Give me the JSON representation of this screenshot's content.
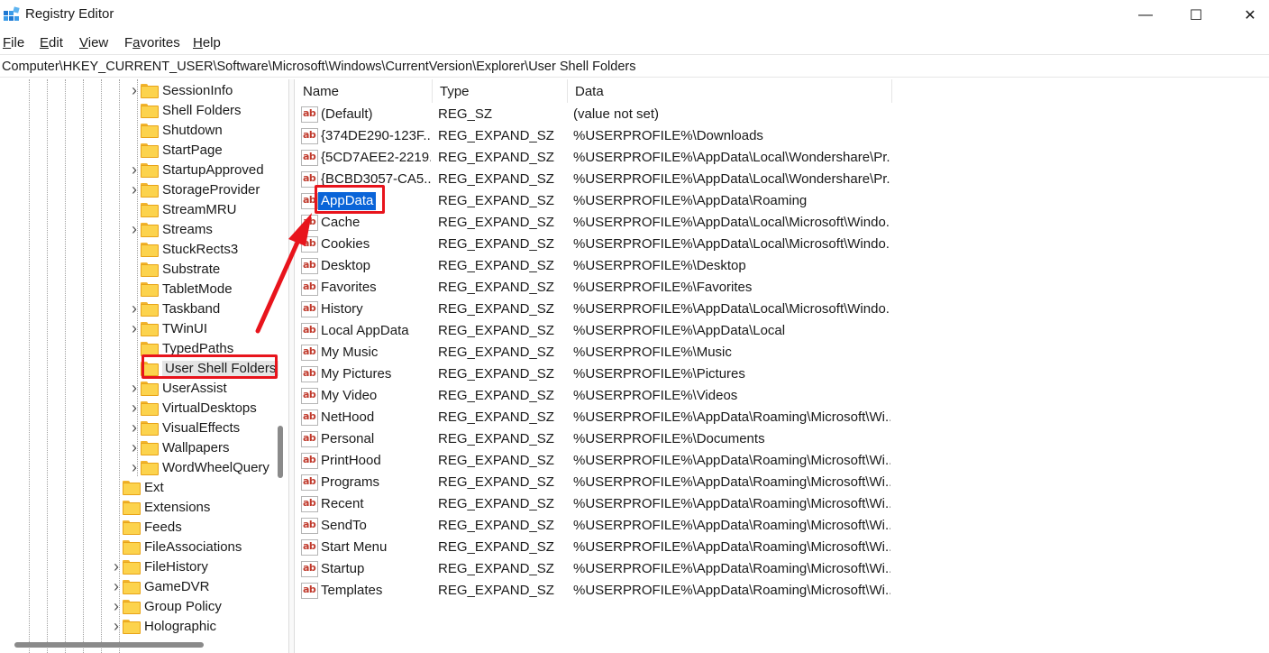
{
  "window": {
    "title": "Registry Editor",
    "minimize_glyph": "—",
    "maximize_glyph": "☐",
    "close_glyph": "✕"
  },
  "menu": [
    {
      "label": "File",
      "mnemonic": "F",
      "rest": "ile"
    },
    {
      "label": "Edit",
      "mnemonic": "E",
      "rest": "dit"
    },
    {
      "label": "View",
      "mnemonic": "V",
      "rest": "iew"
    },
    {
      "label": "Favorites",
      "mnemonic": "a",
      "pre": "F",
      "rest": "vorites"
    },
    {
      "label": "Help",
      "mnemonic": "H",
      "rest": "elp"
    }
  ],
  "address": "Computer\\HKEY_CURRENT_USER\\Software\\Microsoft\\Windows\\CurrentVersion\\Explorer\\User Shell Folders",
  "tree": {
    "deep_items": [
      {
        "label": "SessionInfo",
        "expandable": true
      },
      {
        "label": "Shell Folders",
        "expandable": false
      },
      {
        "label": "Shutdown",
        "expandable": false
      },
      {
        "label": "StartPage",
        "expandable": false
      },
      {
        "label": "StartupApproved",
        "expandable": true
      },
      {
        "label": "StorageProvider",
        "expandable": true
      },
      {
        "label": "StreamMRU",
        "expandable": false
      },
      {
        "label": "Streams",
        "expandable": true
      },
      {
        "label": "StuckRects3",
        "expandable": false
      },
      {
        "label": "Substrate",
        "expandable": false
      },
      {
        "label": "TabletMode",
        "expandable": false
      },
      {
        "label": "Taskband",
        "expandable": true
      },
      {
        "label": "TWinUI",
        "expandable": true
      },
      {
        "label": "TypedPaths",
        "expandable": false
      },
      {
        "label": "User Shell Folders",
        "expandable": false,
        "selected": true
      },
      {
        "label": "UserAssist",
        "expandable": true
      },
      {
        "label": "VirtualDesktops",
        "expandable": true
      },
      {
        "label": "VisualEffects",
        "expandable": true
      },
      {
        "label": "Wallpapers",
        "expandable": true
      },
      {
        "label": "WordWheelQuery",
        "expandable": true
      }
    ],
    "shallow_items": [
      {
        "label": "Ext",
        "expandable": false
      },
      {
        "label": "Extensions",
        "expandable": false
      },
      {
        "label": "Feeds",
        "expandable": false
      },
      {
        "label": "FileAssociations",
        "expandable": false
      },
      {
        "label": "FileHistory",
        "expandable": true
      },
      {
        "label": "GameDVR",
        "expandable": true
      },
      {
        "label": "Group Policy",
        "expandable": true
      },
      {
        "label": "Holographic",
        "expandable": true
      }
    ]
  },
  "columns": {
    "name": "Name",
    "type": "Type",
    "data": "Data"
  },
  "values": [
    {
      "name": "(Default)",
      "type": "REG_SZ",
      "data": "(value not set)"
    },
    {
      "name": "{374DE290-123F...",
      "type": "REG_EXPAND_SZ",
      "data": "%USERPROFILE%\\Downloads"
    },
    {
      "name": "{5CD7AEE2-2219...",
      "type": "REG_EXPAND_SZ",
      "data": "%USERPROFILE%\\AppData\\Local\\Wondershare\\Pr..."
    },
    {
      "name": "{BCBD3057-CA5...",
      "type": "REG_EXPAND_SZ",
      "data": "%USERPROFILE%\\AppData\\Local\\Wondershare\\Pr..."
    },
    {
      "name": "AppData",
      "type": "REG_EXPAND_SZ",
      "data": "%USERPROFILE%\\AppData\\Roaming",
      "selected": true
    },
    {
      "name": "Cache",
      "type": "REG_EXPAND_SZ",
      "data": "%USERPROFILE%\\AppData\\Local\\Microsoft\\Windo..."
    },
    {
      "name": "Cookies",
      "type": "REG_EXPAND_SZ",
      "data": "%USERPROFILE%\\AppData\\Local\\Microsoft\\Windo..."
    },
    {
      "name": "Desktop",
      "type": "REG_EXPAND_SZ",
      "data": "%USERPROFILE%\\Desktop"
    },
    {
      "name": "Favorites",
      "type": "REG_EXPAND_SZ",
      "data": "%USERPROFILE%\\Favorites"
    },
    {
      "name": "History",
      "type": "REG_EXPAND_SZ",
      "data": "%USERPROFILE%\\AppData\\Local\\Microsoft\\Windo..."
    },
    {
      "name": "Local AppData",
      "type": "REG_EXPAND_SZ",
      "data": "%USERPROFILE%\\AppData\\Local"
    },
    {
      "name": "My Music",
      "type": "REG_EXPAND_SZ",
      "data": "%USERPROFILE%\\Music"
    },
    {
      "name": "My Pictures",
      "type": "REG_EXPAND_SZ",
      "data": "%USERPROFILE%\\Pictures"
    },
    {
      "name": "My Video",
      "type": "REG_EXPAND_SZ",
      "data": "%USERPROFILE%\\Videos"
    },
    {
      "name": "NetHood",
      "type": "REG_EXPAND_SZ",
      "data": "%USERPROFILE%\\AppData\\Roaming\\Microsoft\\Wi..."
    },
    {
      "name": "Personal",
      "type": "REG_EXPAND_SZ",
      "data": "%USERPROFILE%\\Documents"
    },
    {
      "name": "PrintHood",
      "type": "REG_EXPAND_SZ",
      "data": "%USERPROFILE%\\AppData\\Roaming\\Microsoft\\Wi..."
    },
    {
      "name": "Programs",
      "type": "REG_EXPAND_SZ",
      "data": "%USERPROFILE%\\AppData\\Roaming\\Microsoft\\Wi..."
    },
    {
      "name": "Recent",
      "type": "REG_EXPAND_SZ",
      "data": "%USERPROFILE%\\AppData\\Roaming\\Microsoft\\Wi..."
    },
    {
      "name": "SendTo",
      "type": "REG_EXPAND_SZ",
      "data": "%USERPROFILE%\\AppData\\Roaming\\Microsoft\\Wi..."
    },
    {
      "name": "Start Menu",
      "type": "REG_EXPAND_SZ",
      "data": "%USERPROFILE%\\AppData\\Roaming\\Microsoft\\Wi..."
    },
    {
      "name": "Startup",
      "type": "REG_EXPAND_SZ",
      "data": "%USERPROFILE%\\AppData\\Roaming\\Microsoft\\Wi..."
    },
    {
      "name": "Templates",
      "type": "REG_EXPAND_SZ",
      "data": "%USERPROFILE%\\AppData\\Roaming\\Microsoft\\Wi..."
    }
  ],
  "value_icon_text": "ab",
  "colors": {
    "annotation_red": "#e8141c",
    "selection_blue": "#0a64d8",
    "folder_yellow": "#fcd34d"
  }
}
